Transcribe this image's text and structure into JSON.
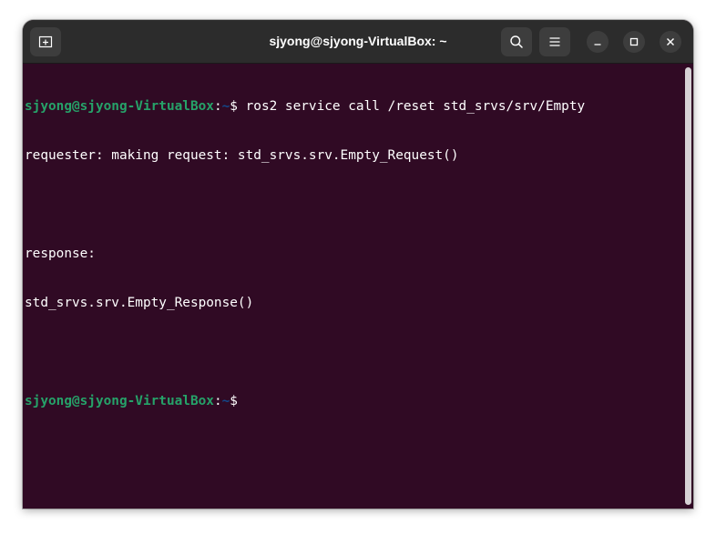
{
  "window": {
    "title": "sjyong@sjyong-VirtualBox: ~"
  },
  "icons": {
    "new_tab": "new-tab-icon",
    "search": "search-icon",
    "menu": "hamburger-menu-icon",
    "minimize": "minimize-icon",
    "maximize": "maximize-icon",
    "close": "close-icon"
  },
  "colors": {
    "terminal_bg": "#300a24",
    "titlebar_bg": "#2c2c2c",
    "prompt_user": "#26a269",
    "prompt_path": "#12488b",
    "text": "#ffffff"
  },
  "terminal": {
    "prompt1": {
      "user_host": "sjyong@sjyong-VirtualBox",
      "sep": ":",
      "path": "~",
      "symbol": "$",
      "command": " ros2 service call /reset std_srvs/srv/Empty"
    },
    "output": [
      "requester: making request: std_srvs.srv.Empty_Request()",
      "",
      "response:",
      "std_srvs.srv.Empty_Response()",
      ""
    ],
    "prompt2": {
      "user_host": "sjyong@sjyong-VirtualBox",
      "sep": ":",
      "path": "~",
      "symbol": "$"
    }
  }
}
